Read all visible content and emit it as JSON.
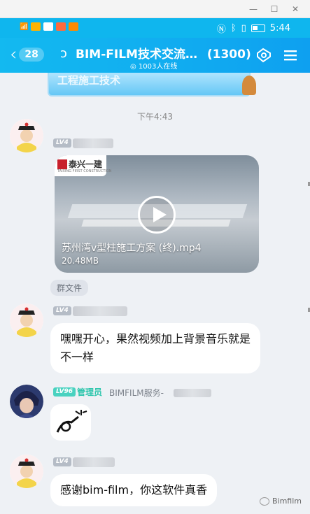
{
  "statusbar": {
    "time": "5:44",
    "left_indicators": [
      "signal-icon",
      "wifi-icon",
      "app-icons"
    ],
    "right_indicators": [
      "nfc-icon",
      "bluetooth-icon",
      "vibrate-icon",
      "battery-icon"
    ]
  },
  "header": {
    "back_count": "28",
    "title": "BIM-FILM技术交流…",
    "member_count": "(1300)",
    "online": "1003人在线"
  },
  "banner": {
    "text": "工程施工技术"
  },
  "chat": {
    "timestamp": "下午4:43",
    "messages": [
      {
        "level": "LV4",
        "type": "video",
        "logo_text": "泰兴一建",
        "logo_sub": "TAIXING FIRST CONSTRUCTION",
        "video_title": "苏州湾v型柱施工方案 (终).mp4",
        "video_size": "20.48MB",
        "file_tag": "群文件"
      },
      {
        "level": "LV4",
        "type": "text",
        "text": "嘿嘿开心，果然视频加上背景音乐就是不一样"
      },
      {
        "level": "LV96",
        "role": "管理员",
        "sender": "BIMFILM服务-",
        "type": "sticker"
      },
      {
        "level": "LV4",
        "type": "text",
        "text": "感谢bim-film，你这软件真香"
      }
    ]
  },
  "watermark": "Bimfilm",
  "colors": {
    "header": "#11aef0",
    "chat_bg": "#eef1f5",
    "admin": "#2fc6ad"
  }
}
